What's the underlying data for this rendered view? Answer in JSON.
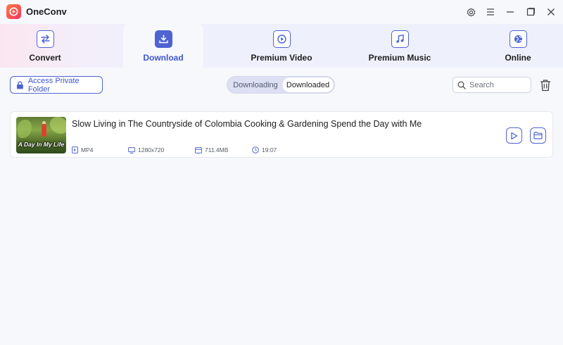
{
  "app": {
    "name": "OneConv"
  },
  "window_controls": [
    "settings-icon",
    "menu-icon",
    "minimize-icon",
    "maximize-icon",
    "close-icon"
  ],
  "nav": {
    "items": [
      {
        "label": "Convert",
        "icon": "convert-icon",
        "active": false
      },
      {
        "label": "Download",
        "icon": "download-icon",
        "active": true
      },
      {
        "label": "Premium Video",
        "icon": "premium-video-icon",
        "active": false
      },
      {
        "label": "Premium Music",
        "icon": "premium-music-icon",
        "active": false
      },
      {
        "label": "Online",
        "icon": "online-icon",
        "active": false
      }
    ]
  },
  "toolbar": {
    "private_folder_label": "Access Private Folder",
    "tabs": {
      "downloading": "Downloading",
      "downloaded": "Downloaded",
      "selected": "Downloaded"
    },
    "search_placeholder": "Search"
  },
  "downloads": [
    {
      "thumbnail_caption": "A Day In My Life",
      "title": "Slow Living in The Countryside of Colombia Cooking & Gardening Spend the Day with Me",
      "format": "MP4",
      "resolution": "1280x720",
      "size": "711.4MB",
      "duration": "19:07"
    }
  ],
  "colors": {
    "accent": "#4f63d2",
    "logo_start": "#ff7a45",
    "logo_end": "#f5365c"
  }
}
